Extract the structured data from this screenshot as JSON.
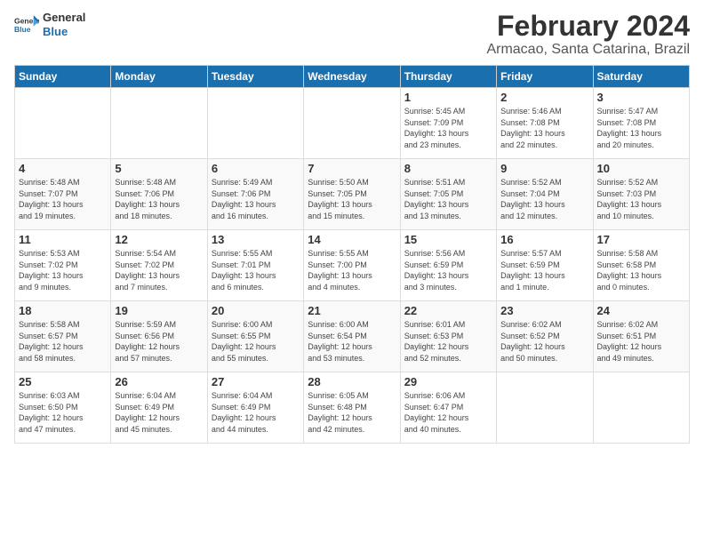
{
  "logo": {
    "line1": "General",
    "line2": "Blue"
  },
  "title": "February 2024",
  "location": "Armacao, Santa Catarina, Brazil",
  "weekdays": [
    "Sunday",
    "Monday",
    "Tuesday",
    "Wednesday",
    "Thursday",
    "Friday",
    "Saturday"
  ],
  "weeks": [
    [
      {
        "day": "",
        "info": ""
      },
      {
        "day": "",
        "info": ""
      },
      {
        "day": "",
        "info": ""
      },
      {
        "day": "",
        "info": ""
      },
      {
        "day": "1",
        "info": "Sunrise: 5:45 AM\nSunset: 7:09 PM\nDaylight: 13 hours\nand 23 minutes."
      },
      {
        "day": "2",
        "info": "Sunrise: 5:46 AM\nSunset: 7:08 PM\nDaylight: 13 hours\nand 22 minutes."
      },
      {
        "day": "3",
        "info": "Sunrise: 5:47 AM\nSunset: 7:08 PM\nDaylight: 13 hours\nand 20 minutes."
      }
    ],
    [
      {
        "day": "4",
        "info": "Sunrise: 5:48 AM\nSunset: 7:07 PM\nDaylight: 13 hours\nand 19 minutes."
      },
      {
        "day": "5",
        "info": "Sunrise: 5:48 AM\nSunset: 7:06 PM\nDaylight: 13 hours\nand 18 minutes."
      },
      {
        "day": "6",
        "info": "Sunrise: 5:49 AM\nSunset: 7:06 PM\nDaylight: 13 hours\nand 16 minutes."
      },
      {
        "day": "7",
        "info": "Sunrise: 5:50 AM\nSunset: 7:05 PM\nDaylight: 13 hours\nand 15 minutes."
      },
      {
        "day": "8",
        "info": "Sunrise: 5:51 AM\nSunset: 7:05 PM\nDaylight: 13 hours\nand 13 minutes."
      },
      {
        "day": "9",
        "info": "Sunrise: 5:52 AM\nSunset: 7:04 PM\nDaylight: 13 hours\nand 12 minutes."
      },
      {
        "day": "10",
        "info": "Sunrise: 5:52 AM\nSunset: 7:03 PM\nDaylight: 13 hours\nand 10 minutes."
      }
    ],
    [
      {
        "day": "11",
        "info": "Sunrise: 5:53 AM\nSunset: 7:02 PM\nDaylight: 13 hours\nand 9 minutes."
      },
      {
        "day": "12",
        "info": "Sunrise: 5:54 AM\nSunset: 7:02 PM\nDaylight: 13 hours\nand 7 minutes."
      },
      {
        "day": "13",
        "info": "Sunrise: 5:55 AM\nSunset: 7:01 PM\nDaylight: 13 hours\nand 6 minutes."
      },
      {
        "day": "14",
        "info": "Sunrise: 5:55 AM\nSunset: 7:00 PM\nDaylight: 13 hours\nand 4 minutes."
      },
      {
        "day": "15",
        "info": "Sunrise: 5:56 AM\nSunset: 6:59 PM\nDaylight: 13 hours\nand 3 minutes."
      },
      {
        "day": "16",
        "info": "Sunrise: 5:57 AM\nSunset: 6:59 PM\nDaylight: 13 hours\nand 1 minute."
      },
      {
        "day": "17",
        "info": "Sunrise: 5:58 AM\nSunset: 6:58 PM\nDaylight: 13 hours\nand 0 minutes."
      }
    ],
    [
      {
        "day": "18",
        "info": "Sunrise: 5:58 AM\nSunset: 6:57 PM\nDaylight: 12 hours\nand 58 minutes."
      },
      {
        "day": "19",
        "info": "Sunrise: 5:59 AM\nSunset: 6:56 PM\nDaylight: 12 hours\nand 57 minutes."
      },
      {
        "day": "20",
        "info": "Sunrise: 6:00 AM\nSunset: 6:55 PM\nDaylight: 12 hours\nand 55 minutes."
      },
      {
        "day": "21",
        "info": "Sunrise: 6:00 AM\nSunset: 6:54 PM\nDaylight: 12 hours\nand 53 minutes."
      },
      {
        "day": "22",
        "info": "Sunrise: 6:01 AM\nSunset: 6:53 PM\nDaylight: 12 hours\nand 52 minutes."
      },
      {
        "day": "23",
        "info": "Sunrise: 6:02 AM\nSunset: 6:52 PM\nDaylight: 12 hours\nand 50 minutes."
      },
      {
        "day": "24",
        "info": "Sunrise: 6:02 AM\nSunset: 6:51 PM\nDaylight: 12 hours\nand 49 minutes."
      }
    ],
    [
      {
        "day": "25",
        "info": "Sunrise: 6:03 AM\nSunset: 6:50 PM\nDaylight: 12 hours\nand 47 minutes."
      },
      {
        "day": "26",
        "info": "Sunrise: 6:04 AM\nSunset: 6:49 PM\nDaylight: 12 hours\nand 45 minutes."
      },
      {
        "day": "27",
        "info": "Sunrise: 6:04 AM\nSunset: 6:49 PM\nDaylight: 12 hours\nand 44 minutes."
      },
      {
        "day": "28",
        "info": "Sunrise: 6:05 AM\nSunset: 6:48 PM\nDaylight: 12 hours\nand 42 minutes."
      },
      {
        "day": "29",
        "info": "Sunrise: 6:06 AM\nSunset: 6:47 PM\nDaylight: 12 hours\nand 40 minutes."
      },
      {
        "day": "",
        "info": ""
      },
      {
        "day": "",
        "info": ""
      }
    ]
  ]
}
